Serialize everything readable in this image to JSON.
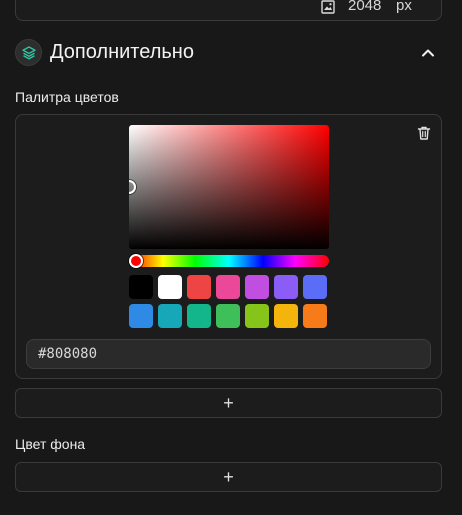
{
  "top_card": {
    "size_value": "2048",
    "size_unit": "px",
    "icon": "image-size-icon"
  },
  "section": {
    "title": "Дополнительно",
    "icon": "layers-icon",
    "toggle_icon": "chevron-up-icon"
  },
  "palette": {
    "label": "Палитра цветов",
    "hex_value": "#808080",
    "delete_icon": "trash-icon",
    "hue_color": "#ff0000",
    "swatches": [
      "#000000",
      "#ffffff",
      "#ef4444",
      "#ec4899",
      "#c04ee0",
      "#8b5cf6",
      "#5b6cf6",
      "#2f8ae6",
      "#16a8b8",
      "#13b58b",
      "#3fbf5a",
      "#86c41a",
      "#f5b40b",
      "#f77b18"
    ]
  },
  "add_color_button": {
    "label": "+"
  },
  "background_color": {
    "label": "Цвет фона",
    "add_label": "+"
  },
  "colors": {
    "page_bg": "#181818",
    "card_border": "#3a3a3a",
    "accent_green": "#2ec4a0"
  }
}
